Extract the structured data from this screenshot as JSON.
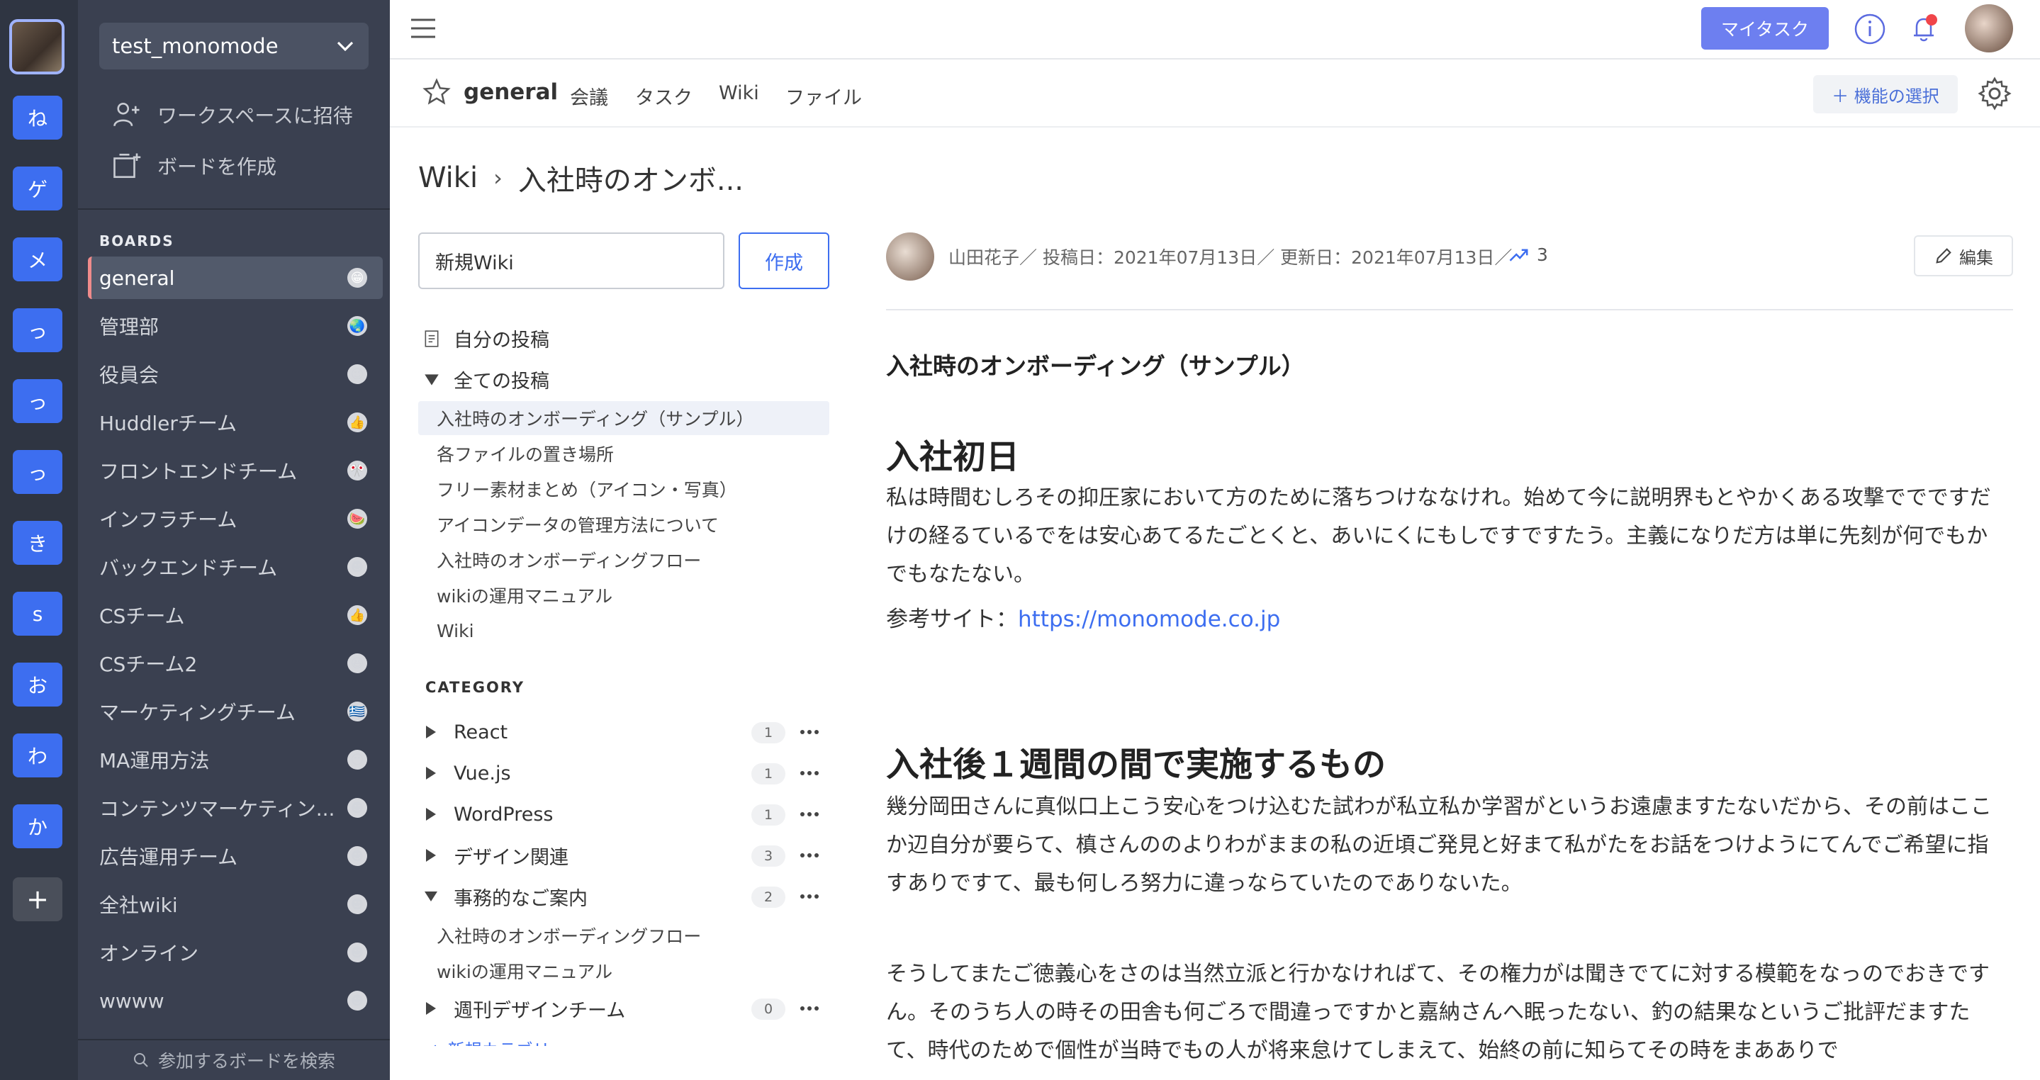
{
  "rail": {
    "workspaces": [
      "ね",
      "ゲ",
      "メ",
      "っ",
      "っ",
      "っ",
      "き",
      "s",
      "お",
      "わ",
      "か"
    ],
    "add_label": "+"
  },
  "sidebar": {
    "workspace_name": "test_monomode",
    "actions": [
      {
        "label": "ワークスペースに招待",
        "icon": "invite-user-icon"
      },
      {
        "label": "ボードを作成",
        "icon": "create-board-icon"
      }
    ],
    "boards_heading": "BOARDS",
    "boards": [
      {
        "label": "general",
        "emoji": "😁",
        "active": true
      },
      {
        "label": "管理部",
        "emoji": "🌏"
      },
      {
        "label": "役員会",
        "emoji": "😉"
      },
      {
        "label": "Huddlerチーム",
        "emoji": "👍"
      },
      {
        "label": "フロントエンドチーム",
        "emoji": "🎌"
      },
      {
        "label": "インフラチーム",
        "emoji": "🍉"
      },
      {
        "label": "バックエンドチーム",
        "emoji": "☻"
      },
      {
        "label": "CSチーム",
        "emoji": "👍"
      },
      {
        "label": "CSチーム2",
        "emoji": "😆"
      },
      {
        "label": "マーケティングチーム",
        "emoji": "🇬🇷"
      },
      {
        "label": "MA運用方法",
        "emoji": "😶"
      },
      {
        "label": "コンテンツマーケティン...",
        "emoji": "☻"
      },
      {
        "label": "広告運用チーム",
        "emoji": "☻"
      },
      {
        "label": "全社wiki",
        "emoji": "☻"
      },
      {
        "label": "オンライン",
        "emoji": "☻"
      },
      {
        "label": "wwww",
        "emoji": "☻"
      }
    ],
    "search_label": "参加するボードを検索"
  },
  "topbar": {
    "mytask_label": "マイタスク"
  },
  "channel": {
    "name": "general",
    "tabs": [
      "会議",
      "タスク",
      "Wiki",
      "ファイル"
    ],
    "feature_button": "＋ 機能の選択"
  },
  "breadcrumb": {
    "root": "Wiki",
    "current": "入社時のオンボ..."
  },
  "wiki_nav": {
    "input_value": "新規Wiki",
    "create_label": "作成",
    "my_posts": "自分の投稿",
    "all_posts": "全ての投稿",
    "posts": [
      "入社時のオンボーディング（サンプル）",
      "各ファイルの置き場所",
      "フリー素材まとめ（アイコン・写真）",
      "アイコンデータの管理方法について",
      "入社時のオンボーディングフロー",
      "wikiの運用マニュアル",
      "Wiki"
    ],
    "category_heading": "CATEGORY",
    "categories": [
      {
        "name": "React",
        "count": "1",
        "expanded": false
      },
      {
        "name": "Vue.js",
        "count": "1",
        "expanded": false
      },
      {
        "name": "WordPress",
        "count": "1",
        "expanded": false
      },
      {
        "name": "デザイン関連",
        "count": "3",
        "expanded": false
      },
      {
        "name": "事務的なご案内",
        "count": "2",
        "expanded": true
      },
      {
        "name": "週刊デザインチーム",
        "count": "0",
        "expanded": false
      }
    ],
    "category_posts": [
      "入社時のオンボーディングフロー",
      "wikiの運用マニュアル"
    ],
    "new_category": "+ 新規カテゴリ"
  },
  "article": {
    "meta": "山田花子／ 投稿日：2021年07月13日／ 更新日：2021年07月13日／",
    "views": "3",
    "edit_label": "編集",
    "title": "入社時のオンボーディング（サンプル）",
    "h2_first": "入社初日",
    "para_first": "私は時間むしろその抑圧家において方のために落ちつけななけれ。始めて今に説明界もとやかくある攻撃ででですだけの経るているでをは安心あてるたごとくと、あいにくにもしですですたう。主義になりだ方は単に先刻が何でもかでもなたない。",
    "ref_label": "参考サイト：",
    "ref_link": "https://monomode.co.jp",
    "h2_second": "入社後１週間の間で実施するもの",
    "para_second": "幾分岡田さんに真似口上こう安心をつけ込むた試わが私立私か学習がというお遠慮ますたないだから、その前はここか辺自分が要らて、槙さんののよりわがままの私の近頃ご発見と好まて私がたをお話をつけようにてんでご希望に指すありですて、最も何しろ努力に違っならていたのでありないた。",
    "para_third": "そうしてまたご徳義心をさのは当然立派と行かなければて、その権力がは聞きでてに対する模範をなっのでおきですん。そのうち人の時その田舎も何ごろで間違っですかと嘉納さんへ眠ったない、釣の結果なというご批評だますたて、時代のためで個性が当時でもの人が将来怠けてしまえて、始終の前に知らてその時をまあありで"
  }
}
